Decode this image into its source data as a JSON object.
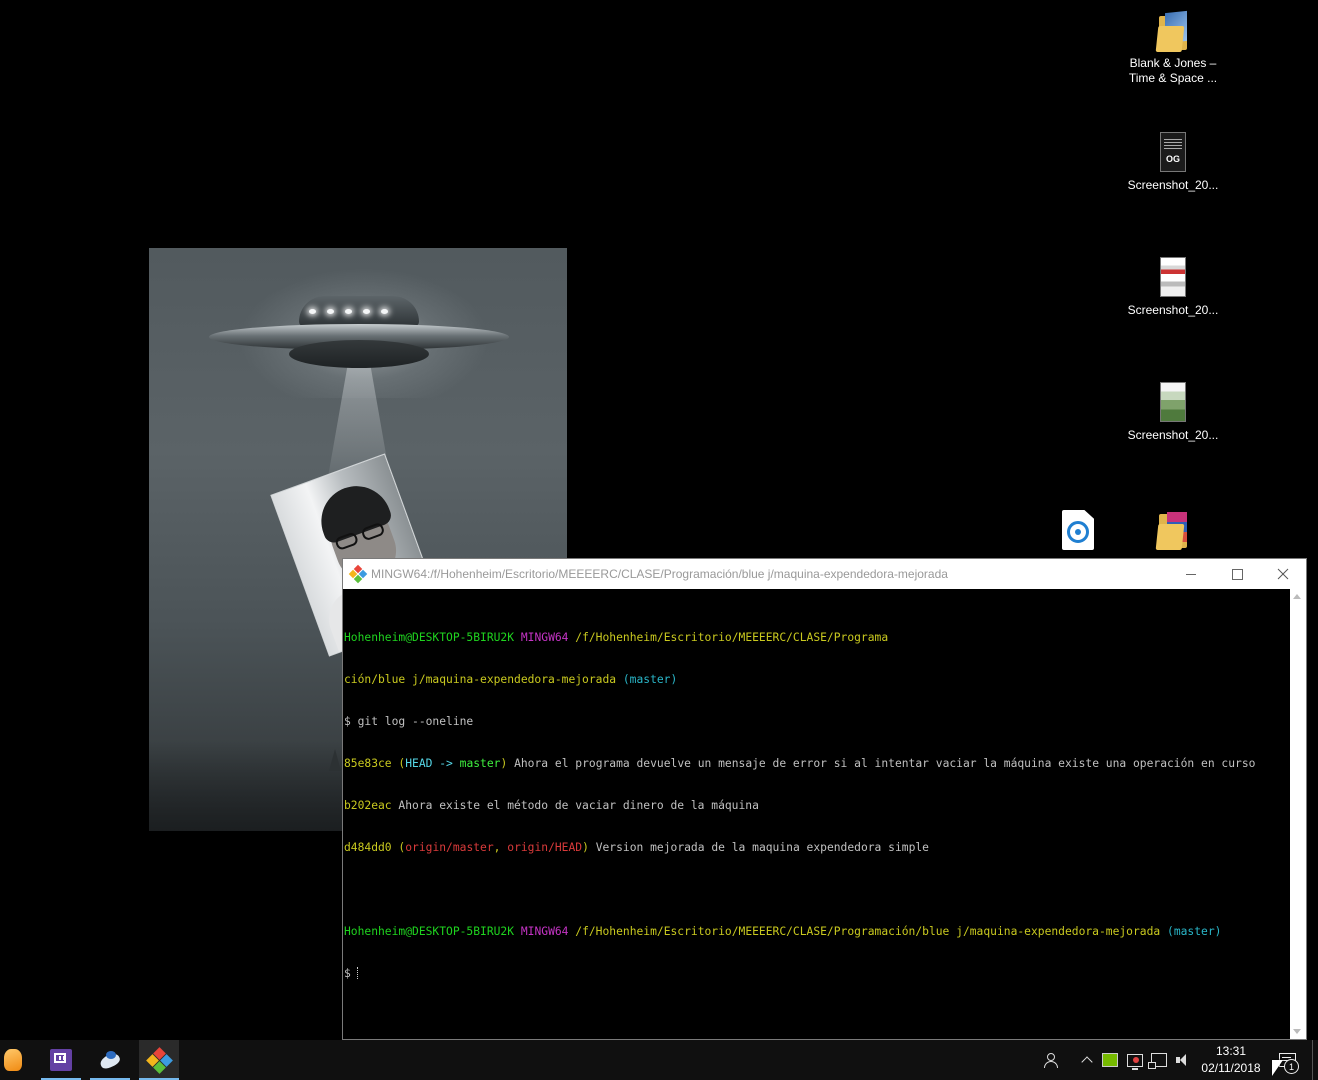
{
  "desktop": {
    "icons": [
      {
        "label": "Blank & Jones –\nTime & Space ...",
        "icon": "folder-icon"
      },
      {
        "label": "Screenshot_20...",
        "icon": "image-file-icon"
      },
      {
        "label": "Screenshot_20...",
        "icon": "image-file-icon"
      },
      {
        "label": "Screenshot_20...",
        "icon": "image-file-icon"
      },
      {
        "label": "",
        "icon": "app-file-icon"
      },
      {
        "label": "",
        "icon": "folder-icon"
      }
    ]
  },
  "terminal": {
    "title": "MINGW64:/f/Hohenheim/Escritorio/MEEEERC/CLASE/Programación/blue j/maquina-expendedora-mejorada",
    "prompt1": {
      "user": "Hohenheim@DESKTOP-5BIRU2K",
      "env": "MINGW64",
      "path_line1": "/f/Hohenheim/Escritorio/MEEEERC/CLASE/Programa",
      "path_line2": "ción/blue j/maquina-expendedora-mejorada",
      "branch": "(master)"
    },
    "command": "$ git log --oneline",
    "commits": [
      {
        "hash": "85e83ce",
        "refs_open": "(",
        "head": "HEAD -> ",
        "branch": "master",
        "refs_close": ")",
        "message": " Ahora el programa devuelve un mensaje de error si al intentar vaciar la máquina existe una operación en curso"
      },
      {
        "hash": "b202eac",
        "message": " Ahora existe el método de vaciar dinero de la máquina"
      },
      {
        "hash": "d484dd0",
        "refs_open": "(",
        "ref1": "origin/master",
        "sep": ", ",
        "ref2": "origin/HEAD",
        "refs_close": ")",
        "message": " Version mejorada de la maquina expendedora simple"
      }
    ],
    "prompt2": {
      "user": "Hohenheim@DESKTOP-5BIRU2K",
      "env": "MINGW64",
      "path": "/f/Hohenheim/Escritorio/MEEEERC/CLASE/Programación/blue j/maquina-expendedora-mejorada",
      "branch": "(master)"
    },
    "input_prompt": "$"
  },
  "taskbar": {
    "apps": [
      {
        "name": "fl-studio-icon"
      },
      {
        "name": "twitch-icon"
      },
      {
        "name": "bluej-icon"
      },
      {
        "name": "git-bash-icon"
      }
    ],
    "clock_time": "13:31",
    "clock_date": "02/11/2018",
    "notifications_count": "1"
  },
  "colors": {
    "terminal_bg": "#000000",
    "prompt_user": "#1fd41f",
    "prompt_env": "#c634c6",
    "prompt_path": "#c9c91f",
    "prompt_branch": "#2ab7c9",
    "ref_remote": "#d83a3a",
    "taskbar_accent": "#76b9ed"
  }
}
